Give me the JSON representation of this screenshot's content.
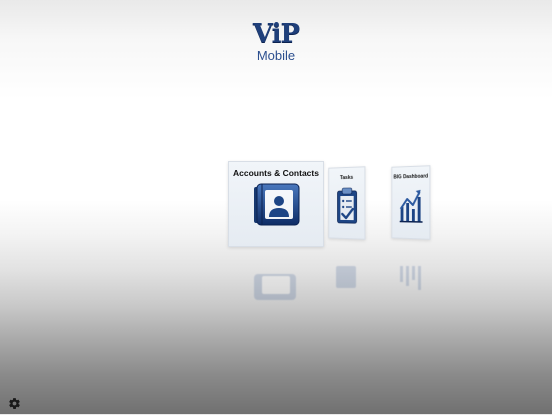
{
  "logo": {
    "brand": "ViP",
    "subtitle": "Mobile"
  },
  "tiles": [
    {
      "label": "Accounts & Contacts",
      "icon": "address-book-icon"
    },
    {
      "label": "Tasks",
      "icon": "clipboard-check-icon"
    },
    {
      "label": "BIG Dashboard",
      "icon": "growth-chart-icon"
    }
  ],
  "settings": {
    "icon": "gear-icon"
  },
  "colors": {
    "brand_blue": "#1f3f7a",
    "icon_blue_dark": "#0f2f6b",
    "icon_blue_light": "#3f6fb5"
  }
}
